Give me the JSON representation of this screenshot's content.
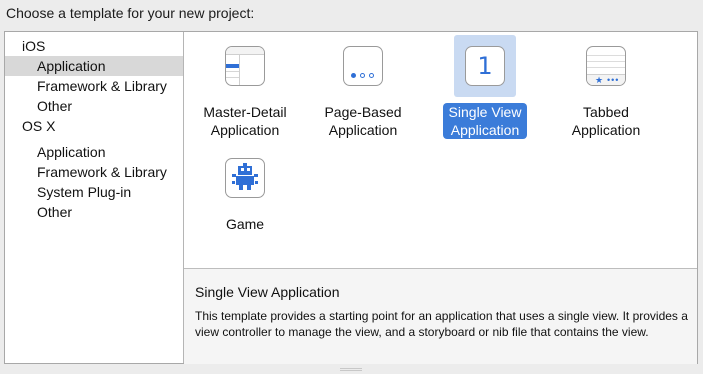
{
  "header": {
    "title": "Choose a template for your new project:"
  },
  "sidebar": {
    "groups": [
      {
        "label": "iOS",
        "items": [
          "Application",
          "Framework & Library",
          "Other"
        ]
      },
      {
        "label": "OS X",
        "items": [
          "Application",
          "Framework & Library",
          "System Plug-in",
          "Other"
        ]
      }
    ],
    "selected": "iOS / Application"
  },
  "templates": [
    {
      "line1": "Master-Detail",
      "line2": "Application",
      "icon": "master-detail-icon",
      "selected": false
    },
    {
      "line1": "Page-Based",
      "line2": "Application",
      "icon": "page-based-icon",
      "selected": false
    },
    {
      "line1": "Single View",
      "line2": "Application",
      "icon": "single-view-icon",
      "icon_text": "1",
      "selected": true
    },
    {
      "line1": "Tabbed",
      "line2": "Application",
      "icon": "tabbed-icon",
      "selected": false
    },
    {
      "line1": "Game",
      "line2": "",
      "icon": "game-robot-icon",
      "selected": false
    }
  ],
  "detail": {
    "title": "Single View Application",
    "description": "This template provides a starting point for an application that uses a single view. It provides a view controller to manage the view, and a storyboard or nib file that contains the view."
  },
  "colors": {
    "selection_blue": "#3b7cd9",
    "selection_tint": "#c9daf2",
    "icon_blue": "#2f6fd6"
  }
}
